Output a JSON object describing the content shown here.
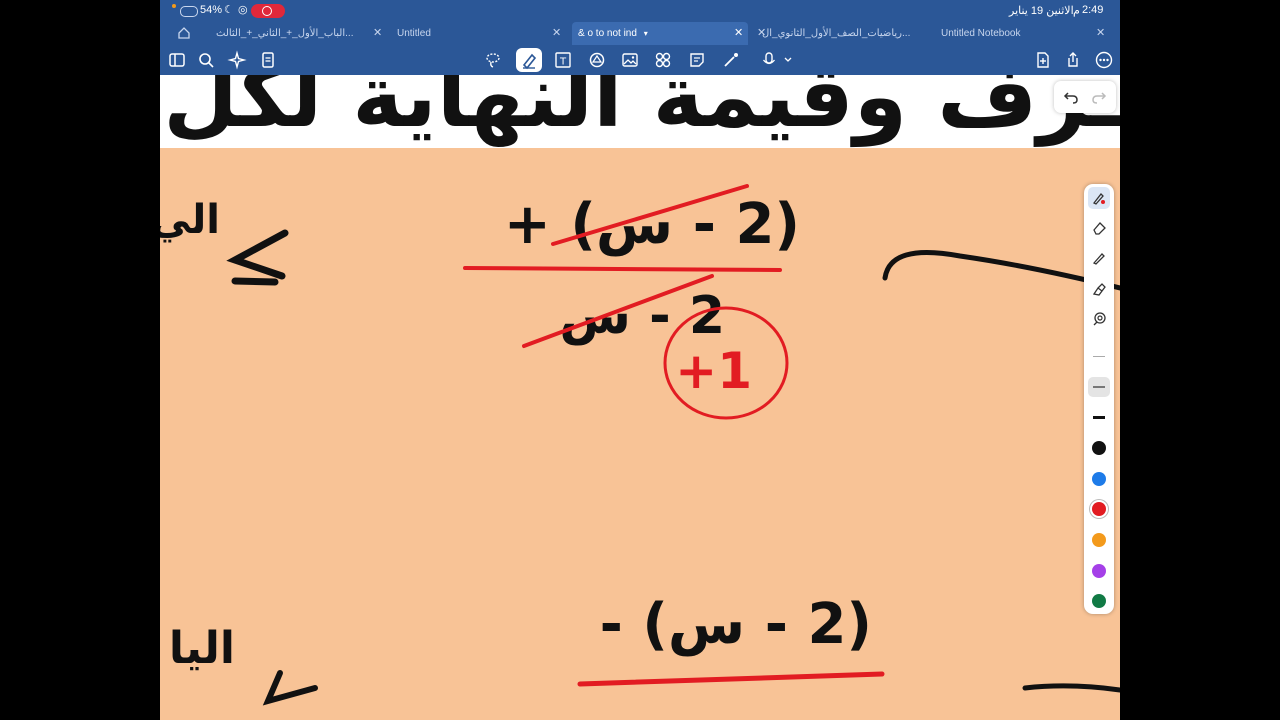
{
  "status": {
    "time": "2:49",
    "ampm": "م",
    "date": "الاثنين 19 يناير",
    "battery": "54%"
  },
  "tabs": [
    {
      "label": "الباب_الأول_+_الثاني_+_الثالث...",
      "active": false
    },
    {
      "label": "Untitled",
      "active": false
    },
    {
      "label": "& o to not ind",
      "active": true
    },
    {
      "label": "رياضيات_الصف_الأول_الثانوي_ال...",
      "active": false
    },
    {
      "label": "Untitled Notebook",
      "active": false
    }
  ],
  "toolbar": {
    "left_icons": [
      "sidebar-icon",
      "search-icon",
      "sparkle-icon",
      "document-icon"
    ],
    "center_icons": [
      "lasso-icon",
      "pen-icon",
      "text-icon",
      "shape-icon",
      "image-icon",
      "elements-icon",
      "sticker-icon",
      "laser-icon",
      "microphone-icon"
    ],
    "right_icons": [
      "add-page-icon",
      "share-icon",
      "more-icon"
    ]
  },
  "page": {
    "title_text": "ـرف وقيمة النهاية لكل من الدو"
  },
  "handwriting": {
    "top_expression_numerator": "(2 - س) +",
    "top_expression_denominator": "2 - س",
    "top_result": "1+",
    "bottom_expression_numerator": "(2 - س) -",
    "left_top_word": "الي",
    "left_bottom_word": "اليا"
  },
  "palette": {
    "tools": [
      "pen-icon",
      "eraser-icon",
      "pencil-icon",
      "highlighter-icon",
      "lasso-tool-icon"
    ],
    "colors": [
      "#111111",
      "#1e7be8",
      "#e21c22",
      "#f39a1c",
      "#a540e8",
      "#117a45"
    ],
    "selected_color": "#e21c22"
  }
}
